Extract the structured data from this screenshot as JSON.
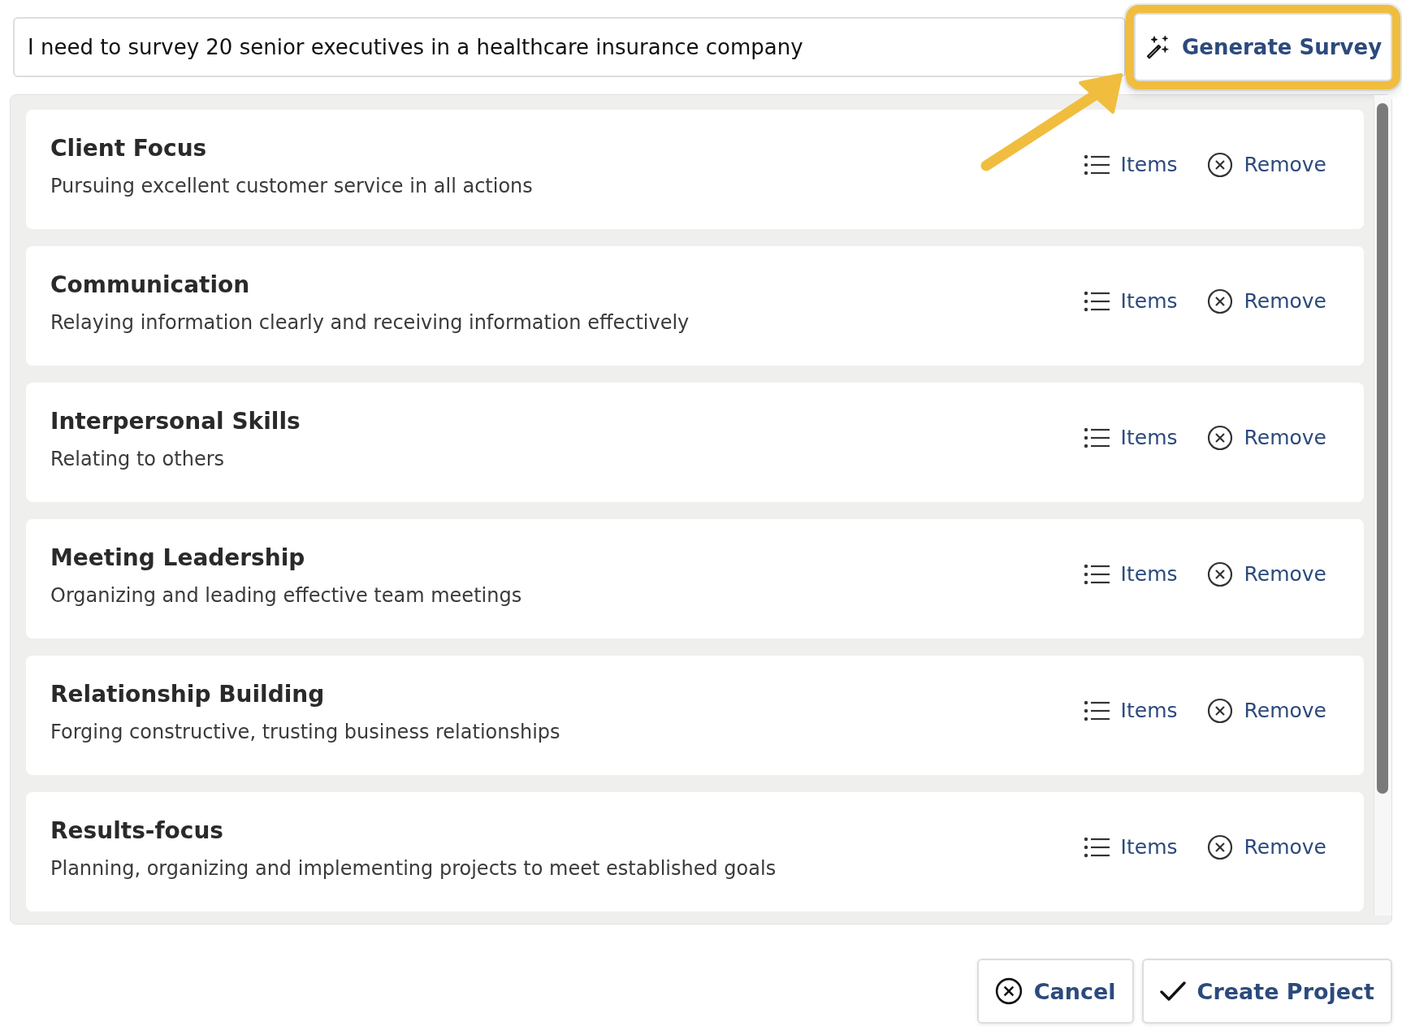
{
  "prompt": {
    "value": "I need to survey 20 senior executives in a healthcare insurance company"
  },
  "generate_button": {
    "label": "Generate Survey",
    "highlighted": true
  },
  "competencies": [
    {
      "title": "Client Focus",
      "description": "Pursuing excellent customer service in all actions",
      "items_label": "Items",
      "remove_label": "Remove"
    },
    {
      "title": "Communication",
      "description": "Relaying information clearly and receiving information effectively",
      "items_label": "Items",
      "remove_label": "Remove"
    },
    {
      "title": "Interpersonal Skills",
      "description": "Relating to others",
      "items_label": "Items",
      "remove_label": "Remove"
    },
    {
      "title": "Meeting Leadership",
      "description": "Organizing and leading effective team meetings",
      "items_label": "Items",
      "remove_label": "Remove"
    },
    {
      "title": "Relationship Building",
      "description": "Forging constructive, trusting business relationships",
      "items_label": "Items",
      "remove_label": "Remove"
    },
    {
      "title": "Results-focus",
      "description": "Planning, organizing and implementing projects to meet established goals",
      "items_label": "Items",
      "remove_label": "Remove"
    }
  ],
  "footer_buttons": [
    {
      "kind": "cancel",
      "label": "Cancel"
    },
    {
      "kind": "confirm",
      "label": "Create Project"
    }
  ]
}
